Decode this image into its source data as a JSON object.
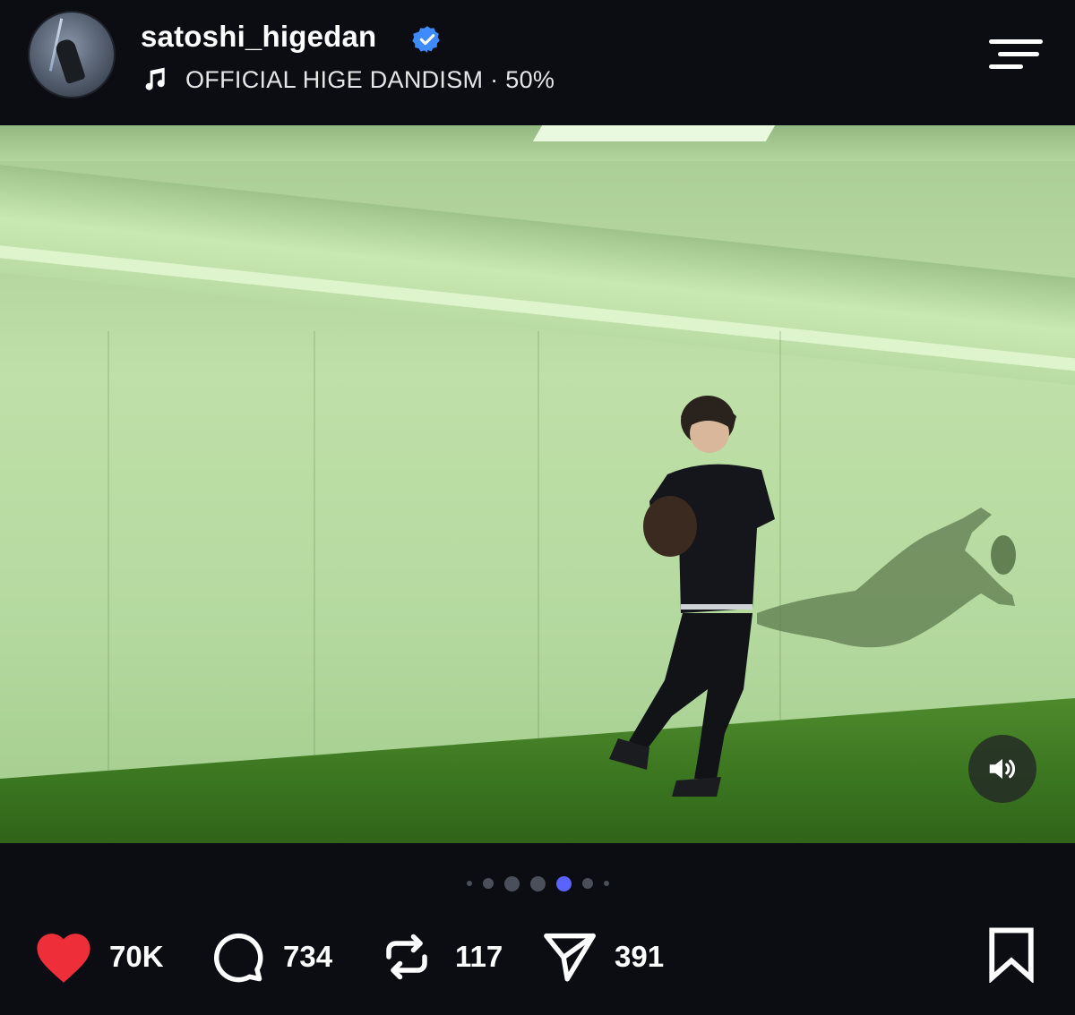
{
  "header": {
    "username": "satoshi_higedan",
    "verified": true,
    "music": {
      "artist": "OFFICIAL HIGE DANDISM",
      "separator": "·",
      "percent": "50%"
    }
  },
  "media": {
    "sound_button": "speaker-icon",
    "carousel": {
      "total": 7,
      "active_index": 4
    }
  },
  "actions": {
    "likes": "70K",
    "comments": "734",
    "reposts": "117",
    "shares": "391"
  },
  "colors": {
    "background": "#0b0d12",
    "like": "#ee2f3a",
    "verified": "#3d8bff",
    "active_dot": "#5b63ff",
    "inactive_dot": "#4a4f5a"
  }
}
